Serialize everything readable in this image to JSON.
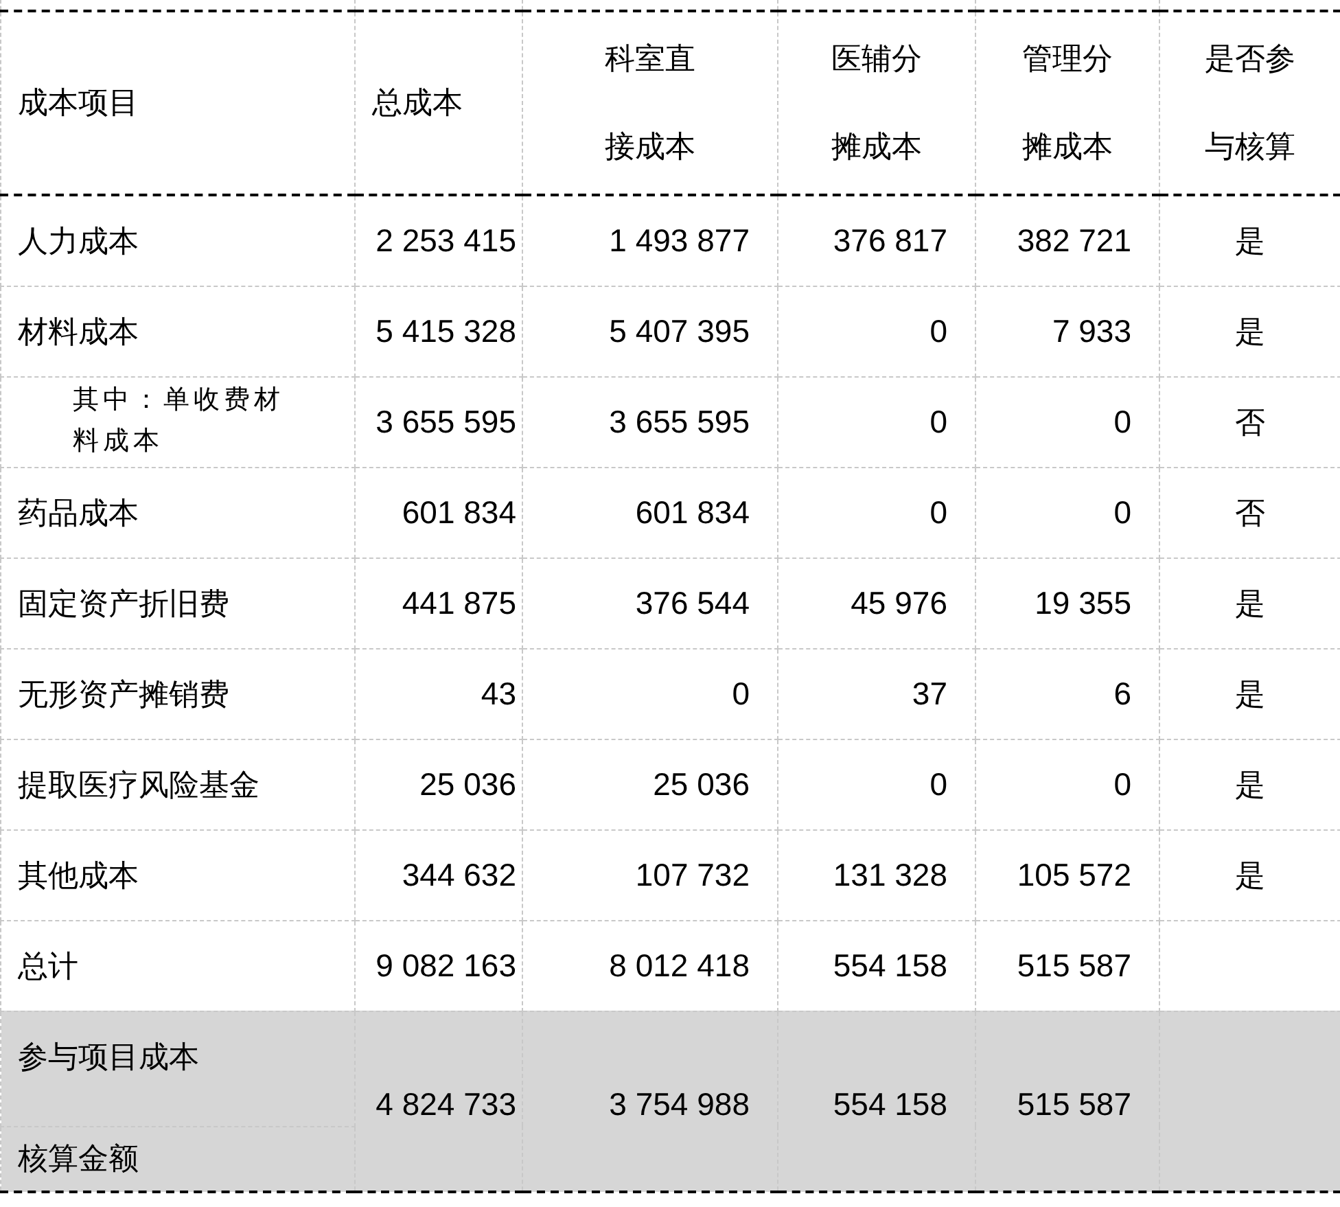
{
  "table": {
    "columns": [
      "成本项目",
      "总成本",
      "科室直接成本",
      "医辅分摊成本",
      "管理分摊成本",
      "是否参与核算"
    ],
    "rows": [
      {
        "kind": "item",
        "cells": [
          "人力成本",
          "2 253 415",
          "1 493 877",
          "376 817",
          "382 721",
          "是"
        ]
      },
      {
        "kind": "item",
        "cells": [
          "材料成本",
          "5 415 328",
          "5 407 395",
          "0",
          "7 933",
          "是"
        ]
      },
      {
        "kind": "sub",
        "cells": [
          "其中：单收费材料成本",
          "3 655 595",
          "3 655 595",
          "0",
          "0",
          "否"
        ]
      },
      {
        "kind": "item",
        "cells": [
          "药品成本",
          "601 834",
          "601 834",
          "0",
          "0",
          "否"
        ]
      },
      {
        "kind": "item",
        "cells": [
          "固定资产折旧费",
          "441 875",
          "376 544",
          "45 976",
          "19 355",
          "是"
        ]
      },
      {
        "kind": "item",
        "cells": [
          "无形资产摊销费",
          "43",
          "0",
          "37",
          "6",
          "是"
        ]
      },
      {
        "kind": "item",
        "cells": [
          "提取医疗风险基金",
          "25 036",
          "25 036",
          "0",
          "0",
          "是"
        ]
      },
      {
        "kind": "item",
        "cells": [
          "其他成本",
          "344 632",
          "107 732",
          "131 328",
          "105 572",
          "是"
        ]
      },
      {
        "kind": "item",
        "cells": [
          "总计",
          "9 082 163",
          "8 012 418",
          "554 158",
          "515 587"
        ]
      }
    ],
    "footer": [
      {
        "cells": [
          "参与项目成本",
          "4 824 733",
          "3 754 988",
          "554 158",
          "515 587"
        ]
      },
      {
        "cells": [
          "核算金额"
        ]
      }
    ]
  }
}
